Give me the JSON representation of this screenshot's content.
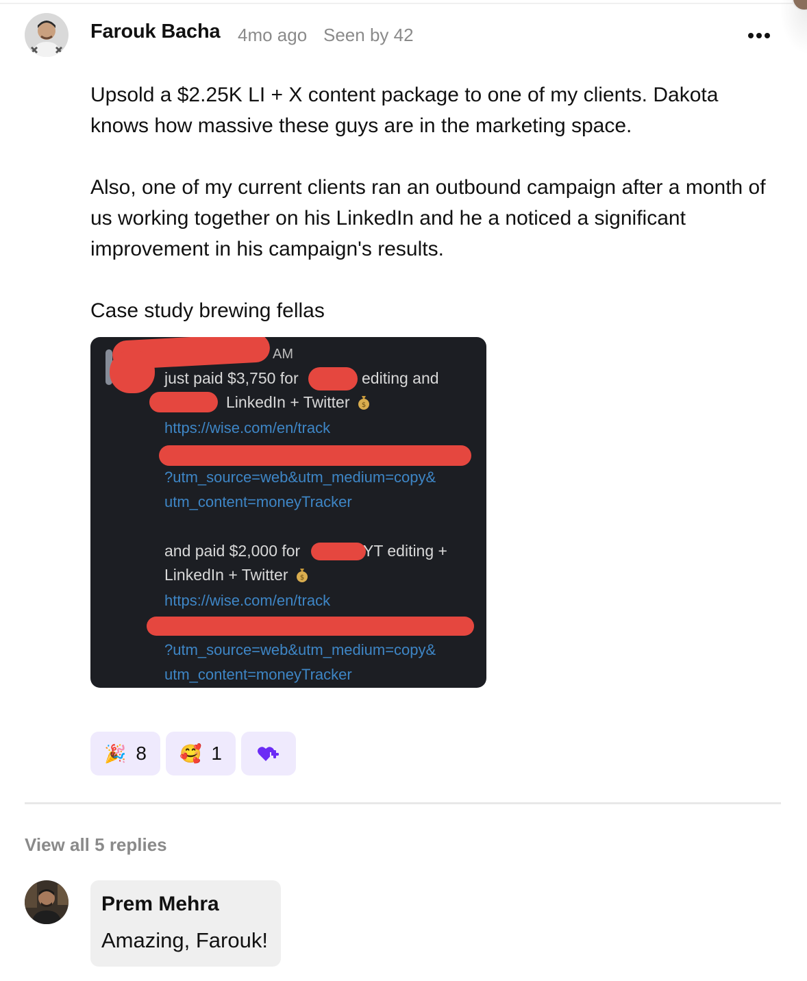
{
  "post": {
    "author": "Farouk Bacha",
    "time": "4mo ago",
    "seen": "Seen by 42",
    "more_icon": "more-horizontal-icon",
    "paragraphs": [
      "Upsold a $2.25K LI + X content package to one of my clients. Dakota knows how massive these guys are in the marketing space.",
      "Also, one of my current clients ran an outbound campaign after a month of us working together on his LinkedIn and he a noticed a significant improvement in his campaign's results.",
      "Case study brewing fellas"
    ],
    "attachment": {
      "time_suffix": "AM",
      "line1": "just paid $3,750 for",
      "line1_end": "editing and",
      "line2": "LinkedIn + Twitter",
      "link1": "https://wise.com/en/track",
      "link1_b": "?utm_source=web&utm_medium=copy&",
      "link1_c": "utm_content=moneyTracker",
      "line3": "and paid $2,000 for",
      "line3_end": "YT editing +",
      "line4": "LinkedIn + Twitter",
      "link2": "https://wise.com/en/track",
      "link2_b": "?utm_source=web&utm_medium=copy&",
      "link2_c": "utm_content=moneyTracker"
    },
    "reactions": [
      {
        "emoji": "🎉",
        "icon": "party-popper-icon",
        "count": "8"
      },
      {
        "emoji": "🥰",
        "icon": "smiling-face-with-hearts-icon",
        "count": "1"
      }
    ],
    "add_reaction_icon": "heart-plus-icon"
  },
  "replies": {
    "view_all": "View all 5 replies",
    "items": [
      {
        "author": "Prem Mehra",
        "text": "Amazing, Farouk!"
      }
    ]
  },
  "colors": {
    "accent": "#6b2cf5",
    "reaction_bg": "#efeafd",
    "muted": "#8a8a8a",
    "reply_bg": "#efefef",
    "redaction": "#e5473f",
    "link": "#3e86c6"
  }
}
